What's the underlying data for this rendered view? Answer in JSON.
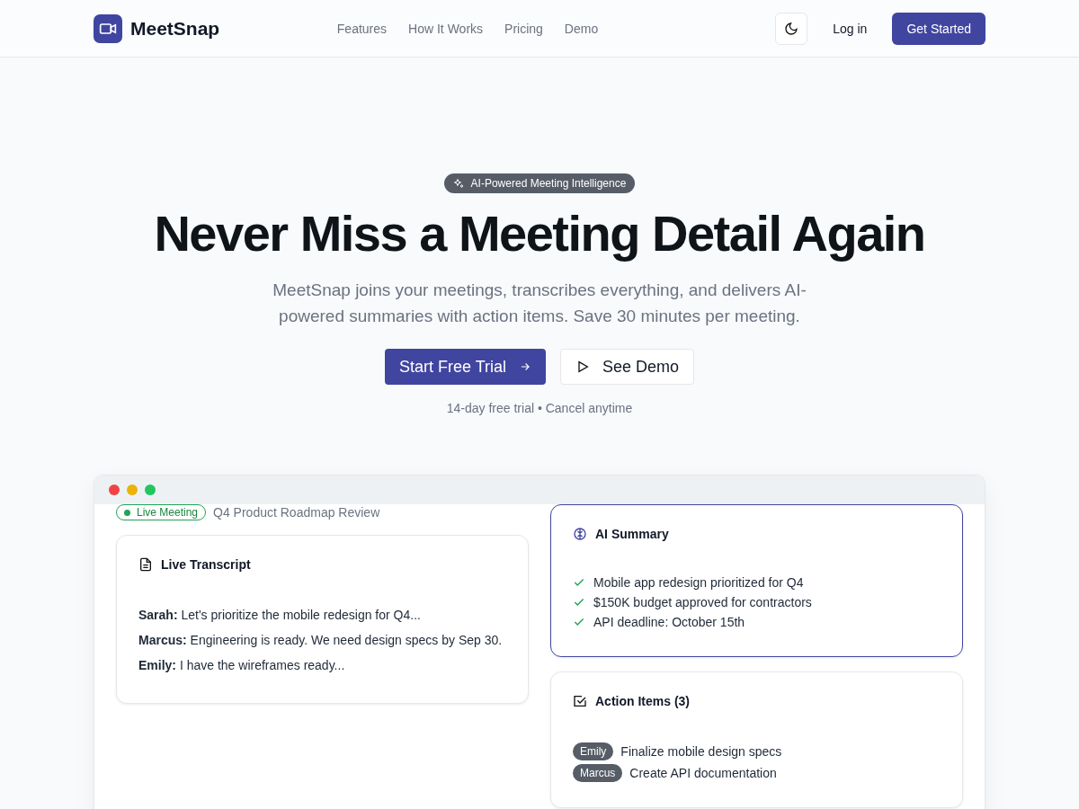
{
  "nav": {
    "brand": "MeetSnap",
    "links": [
      "Features",
      "How It Works",
      "Pricing",
      "Demo"
    ],
    "login": "Log in",
    "cta": "Get Started"
  },
  "hero": {
    "badge": "AI-Powered Meeting Intelligence",
    "title": "Never Miss a Meeting Detail Again",
    "subtitle": "MeetSnap joins your meetings, transcribes everything, and delivers AI-powered summaries with action items. Save 30 minutes per meeting.",
    "primary": "Start Free Trial",
    "secondary": "See Demo",
    "note": "14-day free trial • Cancel anytime"
  },
  "mockup": {
    "status": "Live Meeting",
    "meeting": "Q4 Product Roadmap Review",
    "transcript": {
      "title": "Live Transcript",
      "lines": [
        "**Sarah:** Let's prioritize the mobile redesign for Q4...",
        "**Marcus:** Engineering is ready. We need design specs by Sep 30.",
        "**Emily:** I have the wireframes ready..."
      ]
    },
    "summary": {
      "title": "AI Summary",
      "points": [
        "Mobile app redesign prioritized for Q4",
        "$150K budget approved for contractors",
        "API deadline: October 15th"
      ]
    },
    "actions": {
      "title": "Action Items (3)",
      "items": [
        {
          "owner": "Emily",
          "task": "Finalize mobile design specs"
        },
        {
          "owner": "Marcus",
          "task": "Create API documentation"
        }
      ]
    }
  }
}
